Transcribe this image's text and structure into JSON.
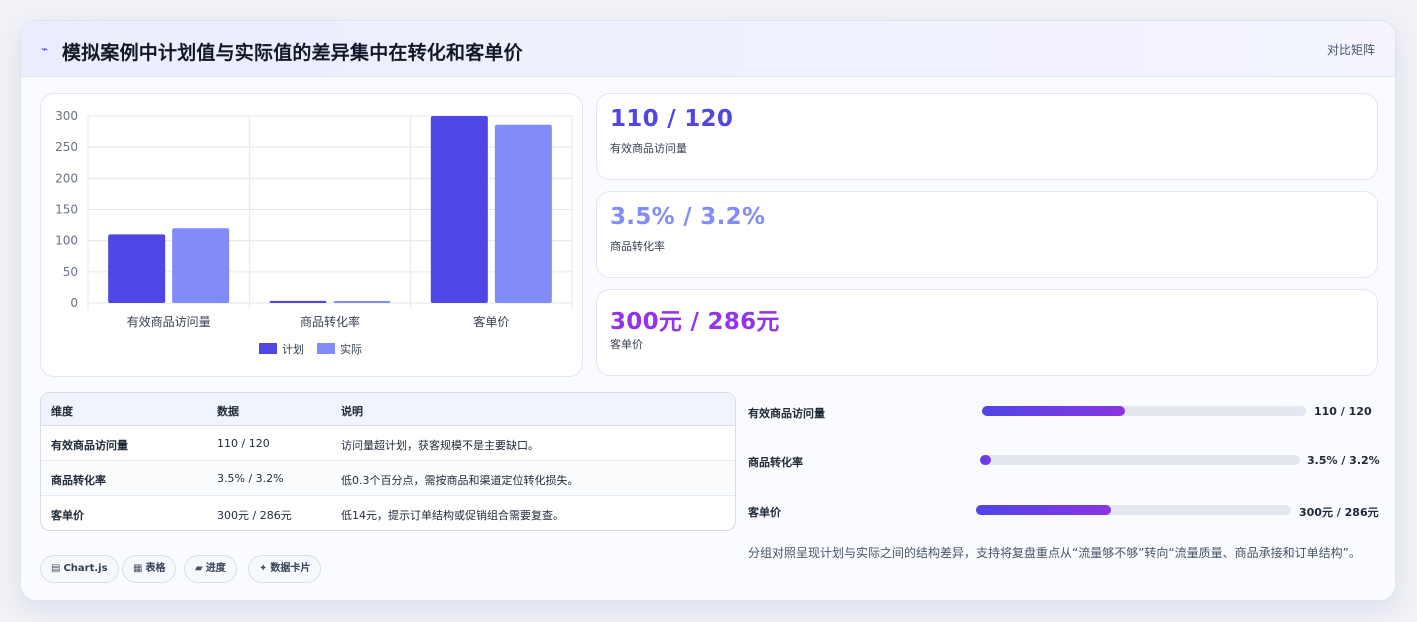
{
  "header": {
    "icon": "pulse-icon",
    "icon_glyph": "⌁",
    "title": "模拟案例中计划值与实际值的差异集中在转化和客单价",
    "link_label": "对比矩阵"
  },
  "chart_data": {
    "type": "bar",
    "title": "",
    "xlabel": "",
    "ylabel": "",
    "categories": [
      "有效商品访问量",
      "商品转化率",
      "客单价"
    ],
    "series": [
      {
        "name": "计划",
        "values": [
          110,
          3.5,
          300
        ],
        "color": "#4f46e5"
      },
      {
        "name": "实际",
        "values": [
          120,
          3.2,
          286
        ],
        "color": "#818cf8"
      }
    ],
    "ylim": [
      0,
      300
    ],
    "yticks": [
      0,
      50,
      100,
      150,
      200,
      250,
      300
    ],
    "grid": true,
    "legend_position": "bottom"
  },
  "metrics": [
    {
      "value": "110 / 120",
      "label": "有效商品访问量",
      "color": "#4f46e5"
    },
    {
      "value": "3.5% / 3.2%",
      "label": "商品转化率",
      "color": "#818cf8"
    },
    {
      "value": "300元 / 286元",
      "label": "客单价",
      "color": "#9333ea"
    }
  ],
  "table": {
    "headers": [
      "维度",
      "数据",
      "说明"
    ],
    "rows": [
      [
        "有效商品访问量",
        "110 / 120",
        "访问量超计划，获客规模不是主要缺口。"
      ],
      [
        "商品转化率",
        "3.5% / 3.2%",
        "低0.3个百分点，需按商品和渠道定位转化损失。"
      ],
      [
        "客单价",
        "300元 / 286元",
        "低14元，提示订单结构或促销组合需要复查。"
      ]
    ]
  },
  "progress": [
    {
      "label": "有效商品访问量",
      "value_text": "110 / 120",
      "fraction": 0.44
    },
    {
      "label": "商品转化率",
      "value_text": "3.5% / 3.2%",
      "fraction": 0.035
    },
    {
      "label": "客单价",
      "value_text": "300元 / 286元",
      "fraction": 0.43
    }
  ],
  "note": "分组对照呈现计划与实际之间的结构差异，支持将复盘重点从“流量够不够”转向“流量质量、商品承接和订单结构”。",
  "chips": [
    {
      "icon": "chart-icon",
      "glyph": "▤",
      "label": "Chart.js"
    },
    {
      "icon": "table-icon",
      "glyph": "▦",
      "label": "表格"
    },
    {
      "icon": "progress-icon",
      "glyph": "▰",
      "label": "进度"
    },
    {
      "icon": "sparkle-icon",
      "glyph": "✦",
      "label": "数据卡片"
    }
  ]
}
